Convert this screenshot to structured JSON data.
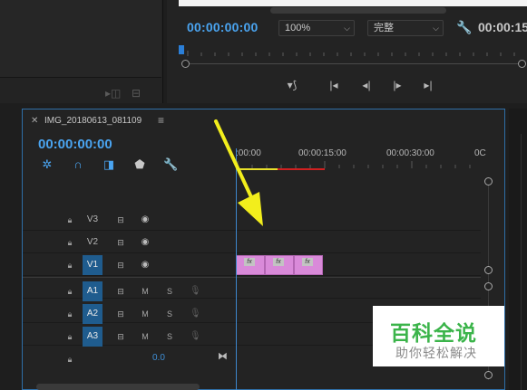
{
  "monitor": {
    "timecode": "00:00:00:00",
    "zoom_select": "100%",
    "quality_select": "完整",
    "duration_timecode": "00:00:15"
  },
  "timeline": {
    "sequence_name": "IMG_20180613_081109",
    "timecode": "00:00:00:00",
    "ruler_labels": [
      ":00:00",
      "00:00:15:00",
      "00:00:30:00",
      "0C"
    ],
    "tracks": {
      "v3": "V3",
      "v2": "V2",
      "v1": "V1",
      "a1": "A1",
      "a2": "A2",
      "a3": "A3",
      "mute": "M",
      "solo": "S"
    },
    "clip_fx_label": "fx",
    "master_volume": "0.0"
  },
  "watermark": {
    "title": "百科全说",
    "subtitle": "助你轻松解决"
  },
  "colors": {
    "accent_blue": "#4aa4f0",
    "clip_pink": "#d98ad9",
    "work_area_red": "#d02020",
    "render_bar_yellow": "#e8e02a",
    "arrow_yellow": "#f2ee1c",
    "watermark_green": "#3bb44a"
  },
  "icons": {
    "ripple_edit": "ripple-icon",
    "snap": "magnet-icon",
    "linked_selection": "link-icon",
    "marker": "marker-icon",
    "settings": "wrench-icon",
    "track_output": "film-icon",
    "eye": "eye-icon",
    "lock": "lock-icon",
    "voiceover": "microphone-icon"
  }
}
